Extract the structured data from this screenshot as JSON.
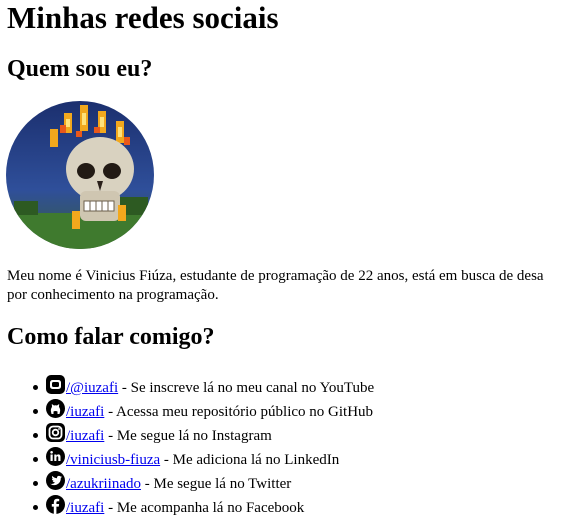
{
  "title": "Minhas redes sociais",
  "about": {
    "heading": "Quem sou eu?",
    "bio_line1": "Meu nome é Vinicius Fiúza, estudante de programação de 22 anos, está em busca de desa",
    "bio_line2": "por conhecimento na programação."
  },
  "contact": {
    "heading": "Como falar comigo?",
    "links": [
      {
        "icon": "youtube-icon",
        "handle": "/@iuzafi",
        "desc": " - Se inscreve lá no meu canal no YouTube"
      },
      {
        "icon": "github-icon",
        "handle": "/iuzafi",
        "desc": " - Acessa meu repositório público no GitHub"
      },
      {
        "icon": "instagram-icon",
        "handle": "/iuzafi",
        "desc": " - Me segue lá no Instagram"
      },
      {
        "icon": "linkedin-icon",
        "handle": "/viniciusb-fiuza",
        "desc": " - Me adiciona lá no LinkedIn"
      },
      {
        "icon": "twitter-icon",
        "handle": "/azukriinado",
        "desc": " - Me segue lá no Twitter"
      },
      {
        "icon": "facebook-icon",
        "handle": "/iuzafi",
        "desc": " - Me acompanha lá no Facebook"
      }
    ]
  },
  "colors": {
    "link": "#0000ee",
    "text": "#000000"
  }
}
